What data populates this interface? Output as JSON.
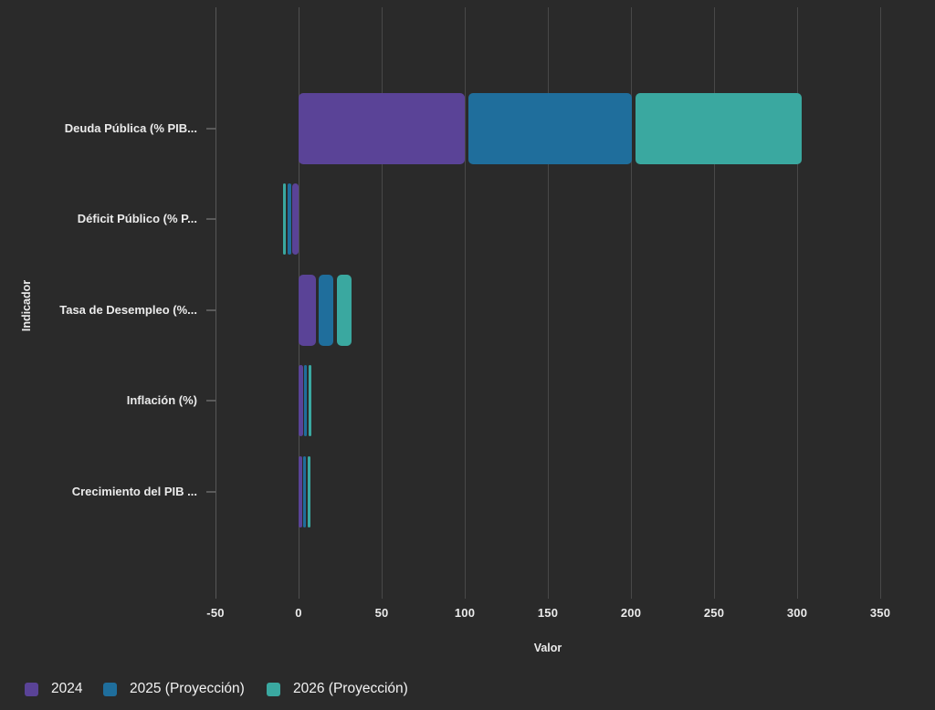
{
  "chart_data": {
    "type": "bar",
    "orientation": "horizontal",
    "stacked": true,
    "title": "",
    "xlabel": "Valor",
    "ylabel": "Indicador",
    "grid": true,
    "legend_position": "bottom-left",
    "xlim": [
      -50,
      383
    ],
    "x_tick_values": [
      -50,
      0,
      50,
      100,
      150,
      200,
      250,
      300,
      350
    ],
    "x_tick_labels": [
      "-50",
      "0",
      "50",
      "100",
      "150",
      "200",
      "250",
      "300",
      "350"
    ],
    "categories": [
      "Deuda Pública (% PIB...",
      "Déficit Público (% P...",
      "Tasa de Desempleo (%...",
      "Inflación (%)",
      "Crecimiento del PIB ..."
    ],
    "series": [
      {
        "name": "2024",
        "color": "#5a4397",
        "values": [
          100.5,
          -4.0,
          10.5,
          3.0,
          2.4
        ]
      },
      {
        "name": "2025 (Proyección)",
        "color": "#1f6e9c",
        "values": [
          100.5,
          -3.0,
          10.7,
          2.3,
          2.3
        ]
      },
      {
        "name": "2026 (Proyección)",
        "color": "#3aa8a0",
        "values": [
          102.2,
          -2.5,
          10.8,
          2.4,
          2.5
        ]
      }
    ]
  },
  "colors": {
    "background": "#2a2a2a",
    "gridline": "#484848",
    "axis_line": "#565656",
    "text": "#ebebeb",
    "series_2024": "#5a4397",
    "series_2025": "#1f6e9c",
    "series_2026": "#3aa8a0"
  }
}
